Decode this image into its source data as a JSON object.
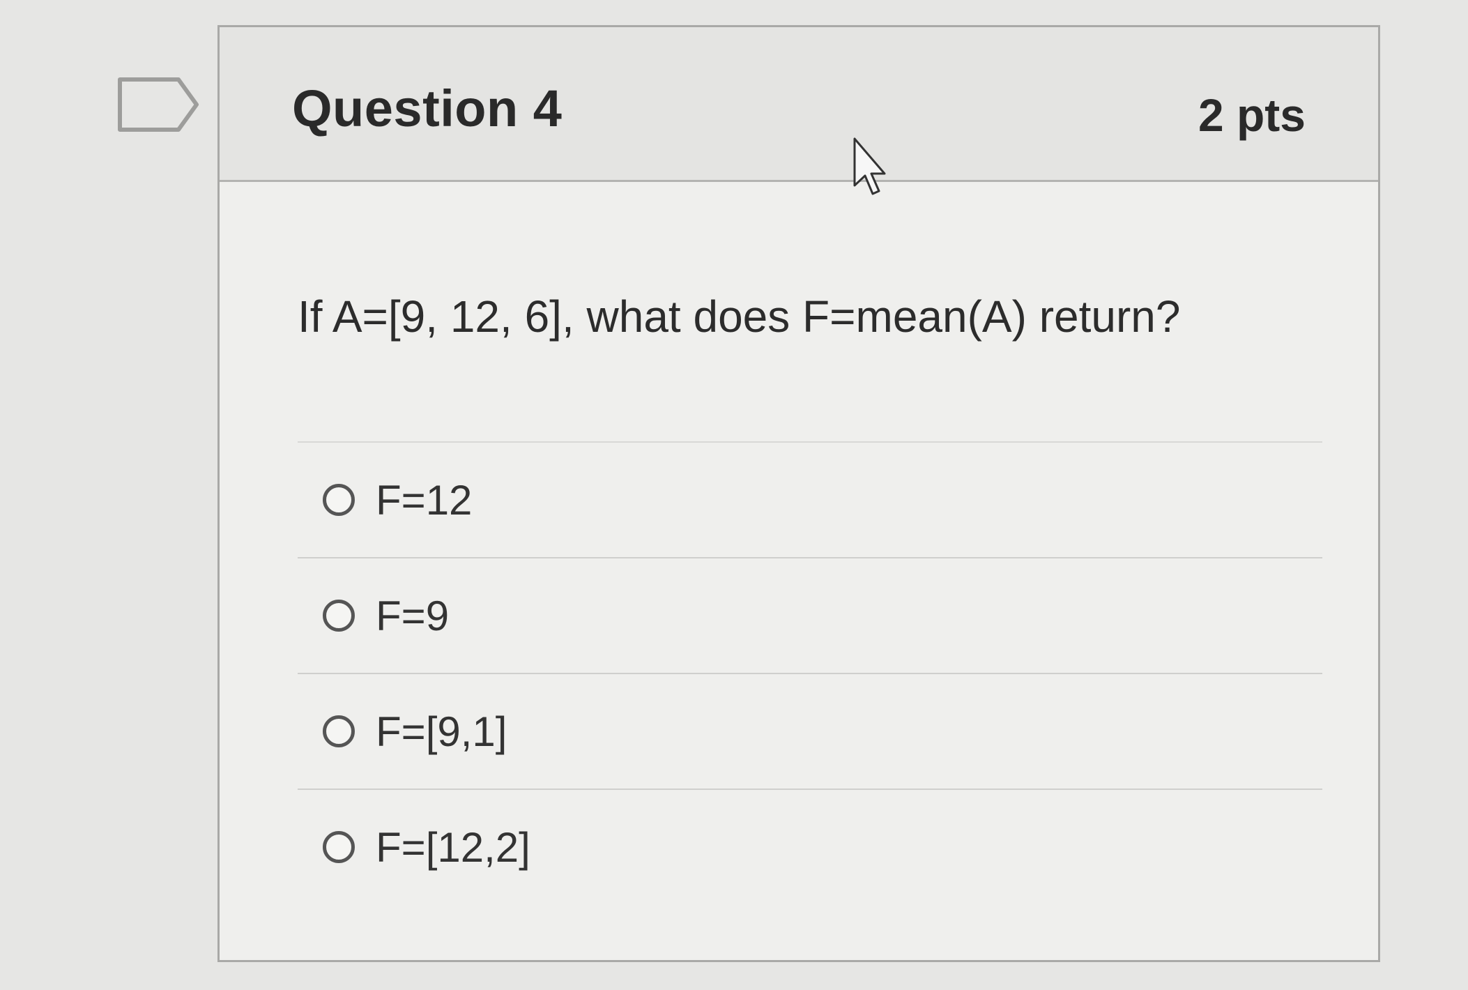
{
  "question": {
    "title": "Question 4",
    "points": "2 pts",
    "text": "If A=[9, 12, 6], what does F=mean(A) return?",
    "answers": [
      "F=12",
      "F=9",
      "F=[9,1]",
      "F=[12,2]"
    ]
  },
  "icons": {
    "flag": "flag-question-icon",
    "cursor": "mouse-pointer-icon"
  },
  "colors": {
    "background": "#e6e6e4",
    "card": "#efefed",
    "text": "#2a2a2a"
  }
}
